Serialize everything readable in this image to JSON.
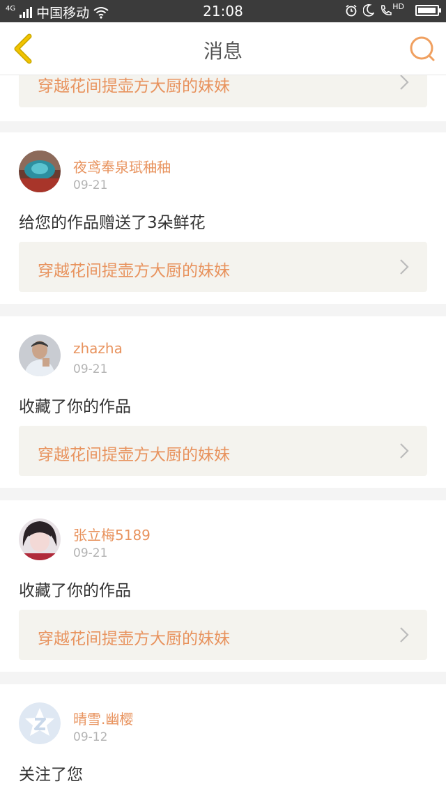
{
  "status_bar": {
    "network": "4G",
    "carrier": "中国移动",
    "time": "21:08",
    "hd_label": "HD",
    "battery_level": 0.95
  },
  "header": {
    "title": "消息",
    "back_icon": "chevron-left-icon",
    "search_icon": "search-icon"
  },
  "colors": {
    "accent": "#e8935e",
    "back_arrow": "#f2c300",
    "work_card_bg": "#f4f3ee",
    "page_bg": "#f4f4f4"
  },
  "notifications": [
    {
      "work_title": "穿越花间提壶方大厨的妹妹",
      "chevron_icon": "chevron-right-icon"
    },
    {
      "user": "夜鸢奉泉珷秞秞",
      "date": "09-21",
      "action": "给您的作品赠送了3朵鲜花",
      "work_title": "穿越花间提壶方大厨的妹妹",
      "chevron_icon": "chevron-right-icon"
    },
    {
      "user": "zhazha",
      "date": "09-21",
      "action": "收藏了你的作品",
      "work_title": "穿越花间提壶方大厨的妹妹",
      "chevron_icon": "chevron-right-icon"
    },
    {
      "user": "张立梅5189",
      "date": "09-21",
      "action": "收藏了你的作品",
      "work_title": "穿越花间提壶方大厨的妹妹",
      "chevron_icon": "chevron-right-icon"
    },
    {
      "user": "晴雪.幽樱",
      "date": "09-12",
      "action": "关注了您",
      "avatar_icon": "default-avatar-icon"
    }
  ]
}
